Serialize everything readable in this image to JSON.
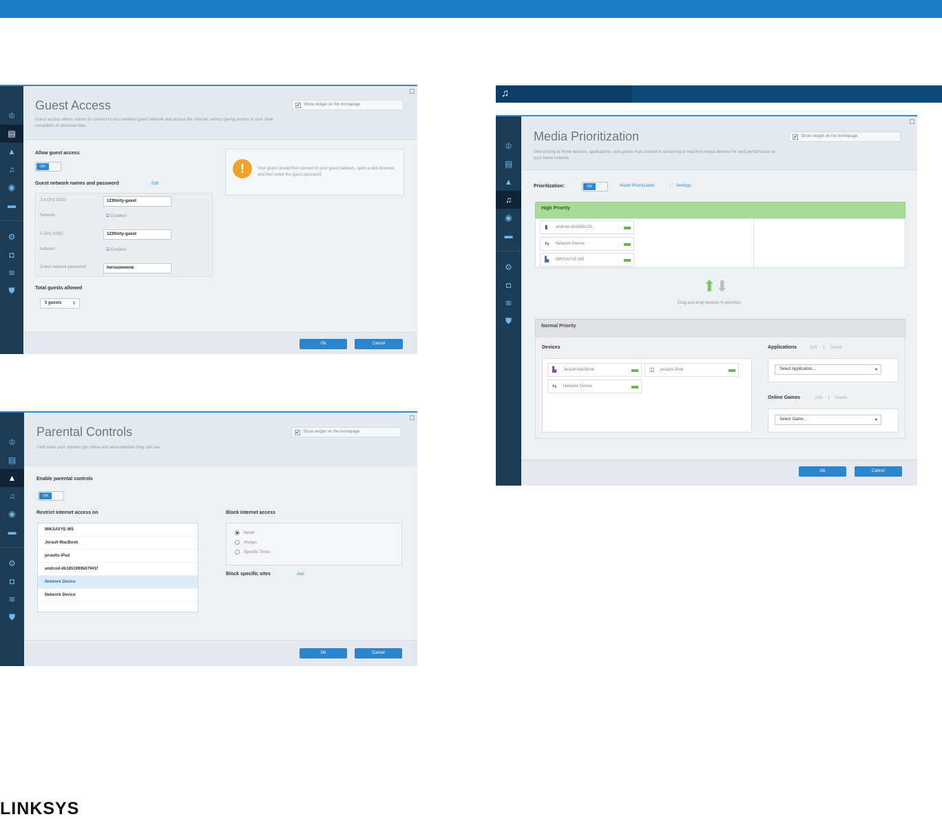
{
  "brand": "LINKSYS",
  "section_tab_icon": "media-prioritization-icon",
  "sidebar_icons": [
    "router-icon",
    "guest-icon",
    "parental-controls-icon",
    "media-prioritization-icon",
    "speed-test-icon",
    "external-storage-icon",
    "connectivity-icon",
    "troubleshooting-icon",
    "wireless-icon",
    "security-icon"
  ],
  "guest": {
    "title": "Guest Access",
    "desc": "Guest access allows visitors to connect to your wireless guest network and access the Internet, without giving access to your other computers or personal data.",
    "widget": "Show widget on the homepage",
    "allow_label": "Allow guest access",
    "toggle": "ON",
    "names_label": "Guest network names and password",
    "names_edit": "Edit",
    "ssid24_label": "2.4 GHz SSID:",
    "ssid24_value": "123thirty-guest",
    "network_label": "Network:",
    "enabled": "Enabled",
    "ssid5_label": "5 GHz SSID:",
    "ssid5_value": "123thirty-guest",
    "password_label": "Guest network password:",
    "password_value": "herosomeone",
    "total_label": "Total guests allowed",
    "total_value": "5 guests",
    "notice": "Your guest should first connect to your guest network, open a web browser, and then enter the guest password.",
    "ok": "Ok",
    "cancel": "Cancel"
  },
  "parental": {
    "title": "Parental Controls",
    "desc": "Limit when your children get online and what websites they can see.",
    "widget": "Show widget on the homepage",
    "enable_label": "Enable parental controls",
    "toggle": "ON",
    "restrict_label": "Restrict Internet access on",
    "devices": [
      "MIKSAVYE-W5",
      "Jerault-MacBook",
      "jeraults-iPad",
      "android-db1851999b67941f",
      "Network Device",
      "Network Device"
    ],
    "block_label": "Block Internet access",
    "radios": [
      "Never",
      "Always",
      "Specific Times"
    ],
    "sites_label": "Block specific sites",
    "sites_add": "Add",
    "ok": "Ok",
    "cancel": "Cancel"
  },
  "media": {
    "title": "Media Prioritization",
    "desc": "Give priority to those devices, applications, and games that connect to streaming or real-time media devices for best performance on your home network.",
    "widget": "Show widget on the homepage",
    "prio_label": "Prioritization:",
    "toggle": "ON",
    "reset": "Reset Prioritization",
    "settings": "Settings",
    "high": "High Priority",
    "high_devices": [
      "android-db1885109...",
      "Network Device",
      "MIKSAVYE-W5"
    ],
    "drag_hint": "Drag and drop devices to prioritize",
    "normal": "Normal Priority",
    "devices_label": "Devices",
    "normal_devices": [
      "Jerault-MacBook",
      "jeraults-iPad",
      "Network Device"
    ],
    "apps_label": "Applications",
    "apps_edit": "Edit",
    "apps_delete": "Delete",
    "apps_select": "Select Application...",
    "games_label": "Online Games",
    "games_edit": "Edit",
    "games_delete": "Delete",
    "games_select": "Select Game...",
    "ok": "Ok",
    "cancel": "Cancel"
  }
}
